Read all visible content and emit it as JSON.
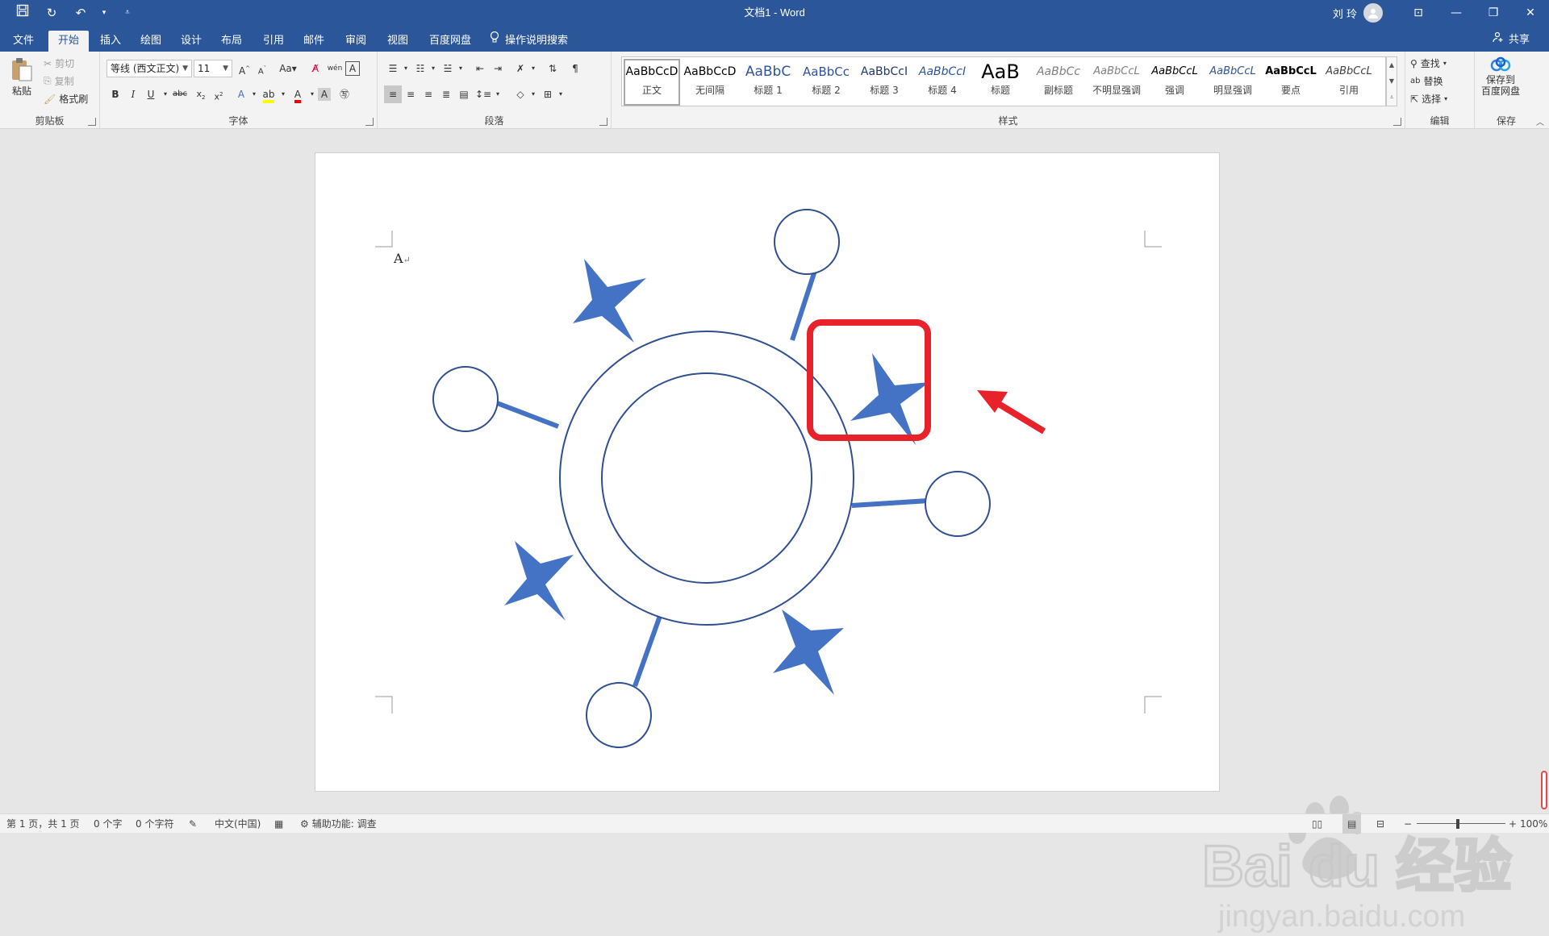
{
  "window": {
    "title": "文档1  -  Word",
    "user": "刘 玲",
    "share_label": "共享"
  },
  "tabs": [
    {
      "label": "文件"
    },
    {
      "label": "开始",
      "active": true
    },
    {
      "label": "插入"
    },
    {
      "label": "绘图"
    },
    {
      "label": "设计"
    },
    {
      "label": "布局"
    },
    {
      "label": "引用"
    },
    {
      "label": "邮件"
    },
    {
      "label": "审阅"
    },
    {
      "label": "视图"
    },
    {
      "label": "百度网盘"
    }
  ],
  "tellme": "操作说明搜索",
  "ribbon": {
    "clipboard": {
      "label": "剪贴板",
      "paste": "粘贴",
      "cut": "剪切",
      "copy": "复制",
      "format_painter": "格式刷"
    },
    "font": {
      "label": "字体",
      "font_name": "等线 (西文正文)",
      "font_size": "11"
    },
    "paragraph": {
      "label": "段落"
    },
    "styles": {
      "label": "样式",
      "items": [
        {
          "preview": "AaBbCcD",
          "name": "正文",
          "selected": true
        },
        {
          "preview": "AaBbCcD",
          "name": "无间隔"
        },
        {
          "preview": "AaBbC",
          "name": "标题 1"
        },
        {
          "preview": "AaBbCc",
          "name": "标题 2"
        },
        {
          "preview": "AaBbCcI",
          "name": "标题 3"
        },
        {
          "preview": "AaBbCcI",
          "name": "标题 4"
        },
        {
          "preview": "AaB",
          "name": "标题"
        },
        {
          "preview": "AaBbCc",
          "name": "副标题"
        },
        {
          "preview": "AaBbCcL",
          "name": "不明显强调"
        },
        {
          "preview": "AaBbCcL",
          "name": "强调"
        },
        {
          "preview": "AaBbCcL",
          "name": "明显强调"
        },
        {
          "preview": "AaBbCcL",
          "name": "要点"
        },
        {
          "preview": "AaBbCcL",
          "name": "引用"
        }
      ]
    },
    "editing": {
      "label": "编辑",
      "find": "查找",
      "replace": "替换",
      "select": "选择"
    },
    "save": {
      "label": "保存",
      "save_to_cloud_line1": "保存到",
      "save_to_cloud_line2": "百度网盘"
    }
  },
  "document": {
    "text": "A"
  },
  "status": {
    "page": "第 1 页，共 1 页",
    "words": "0 个字",
    "chars": "0 个字符",
    "language": "中文(中国)",
    "accessibility": "辅助功能: 调查",
    "zoom": "100%"
  },
  "watermark": {
    "brand": "Bai du 经验",
    "url": "jingyan.baidu.com"
  },
  "colors": {
    "title_bar": "#2b579a",
    "shape_fill": "#4472c4",
    "shape_stroke": "#2f4f8f",
    "highlight": "#e8222b"
  }
}
